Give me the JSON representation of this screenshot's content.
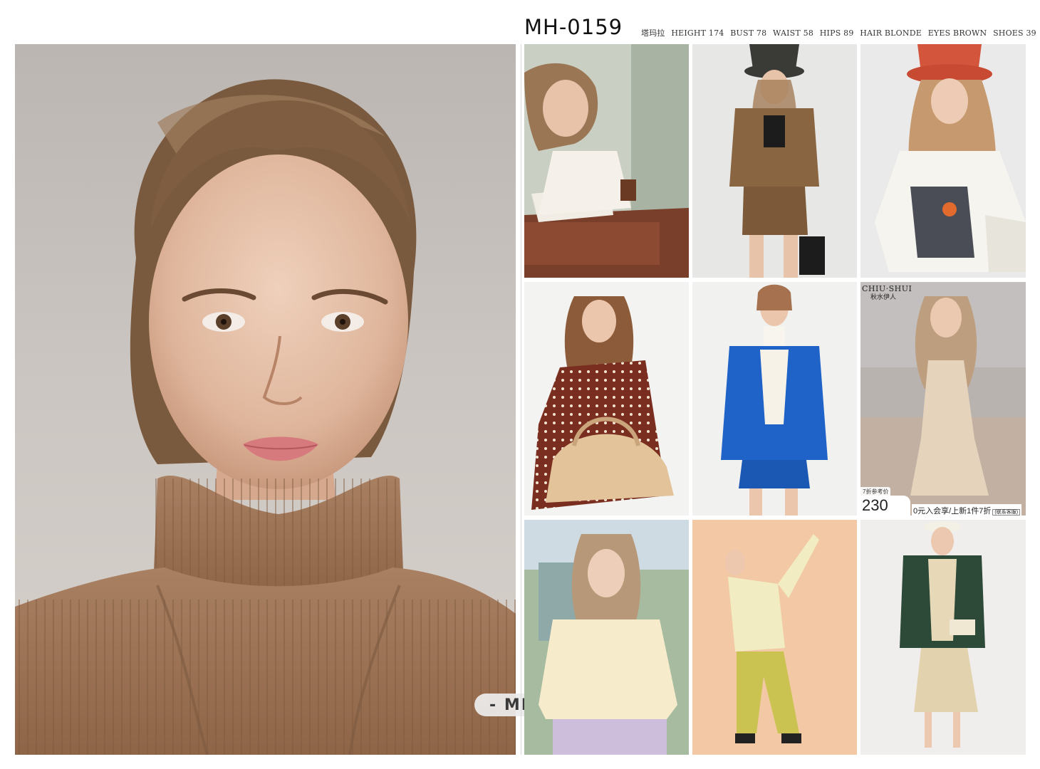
{
  "header": {
    "model_code": "MH-0159",
    "stats": [
      "塔玛拉",
      "HEIGHT 174",
      "BUST 78",
      "WAIST 58",
      "HIPS 89",
      "HAIR BLONDE",
      "EYES BROWN",
      "SHOES 39"
    ]
  },
  "watermark": "- MH -",
  "grid": {
    "brand_line1": "CHIU·SHUI",
    "brand_line2": "秋水伊人",
    "promo_tag": "7折参考价",
    "promo_price": "230",
    "promo_text": "0元入会享/上新1件7折",
    "promo_small": "(联系客服)"
  },
  "colors": {
    "sweater": "#a47a57",
    "blue_jacket": "#1f63c8",
    "red_hat": "#d2553c",
    "green_blazer": "#2c4a37"
  }
}
